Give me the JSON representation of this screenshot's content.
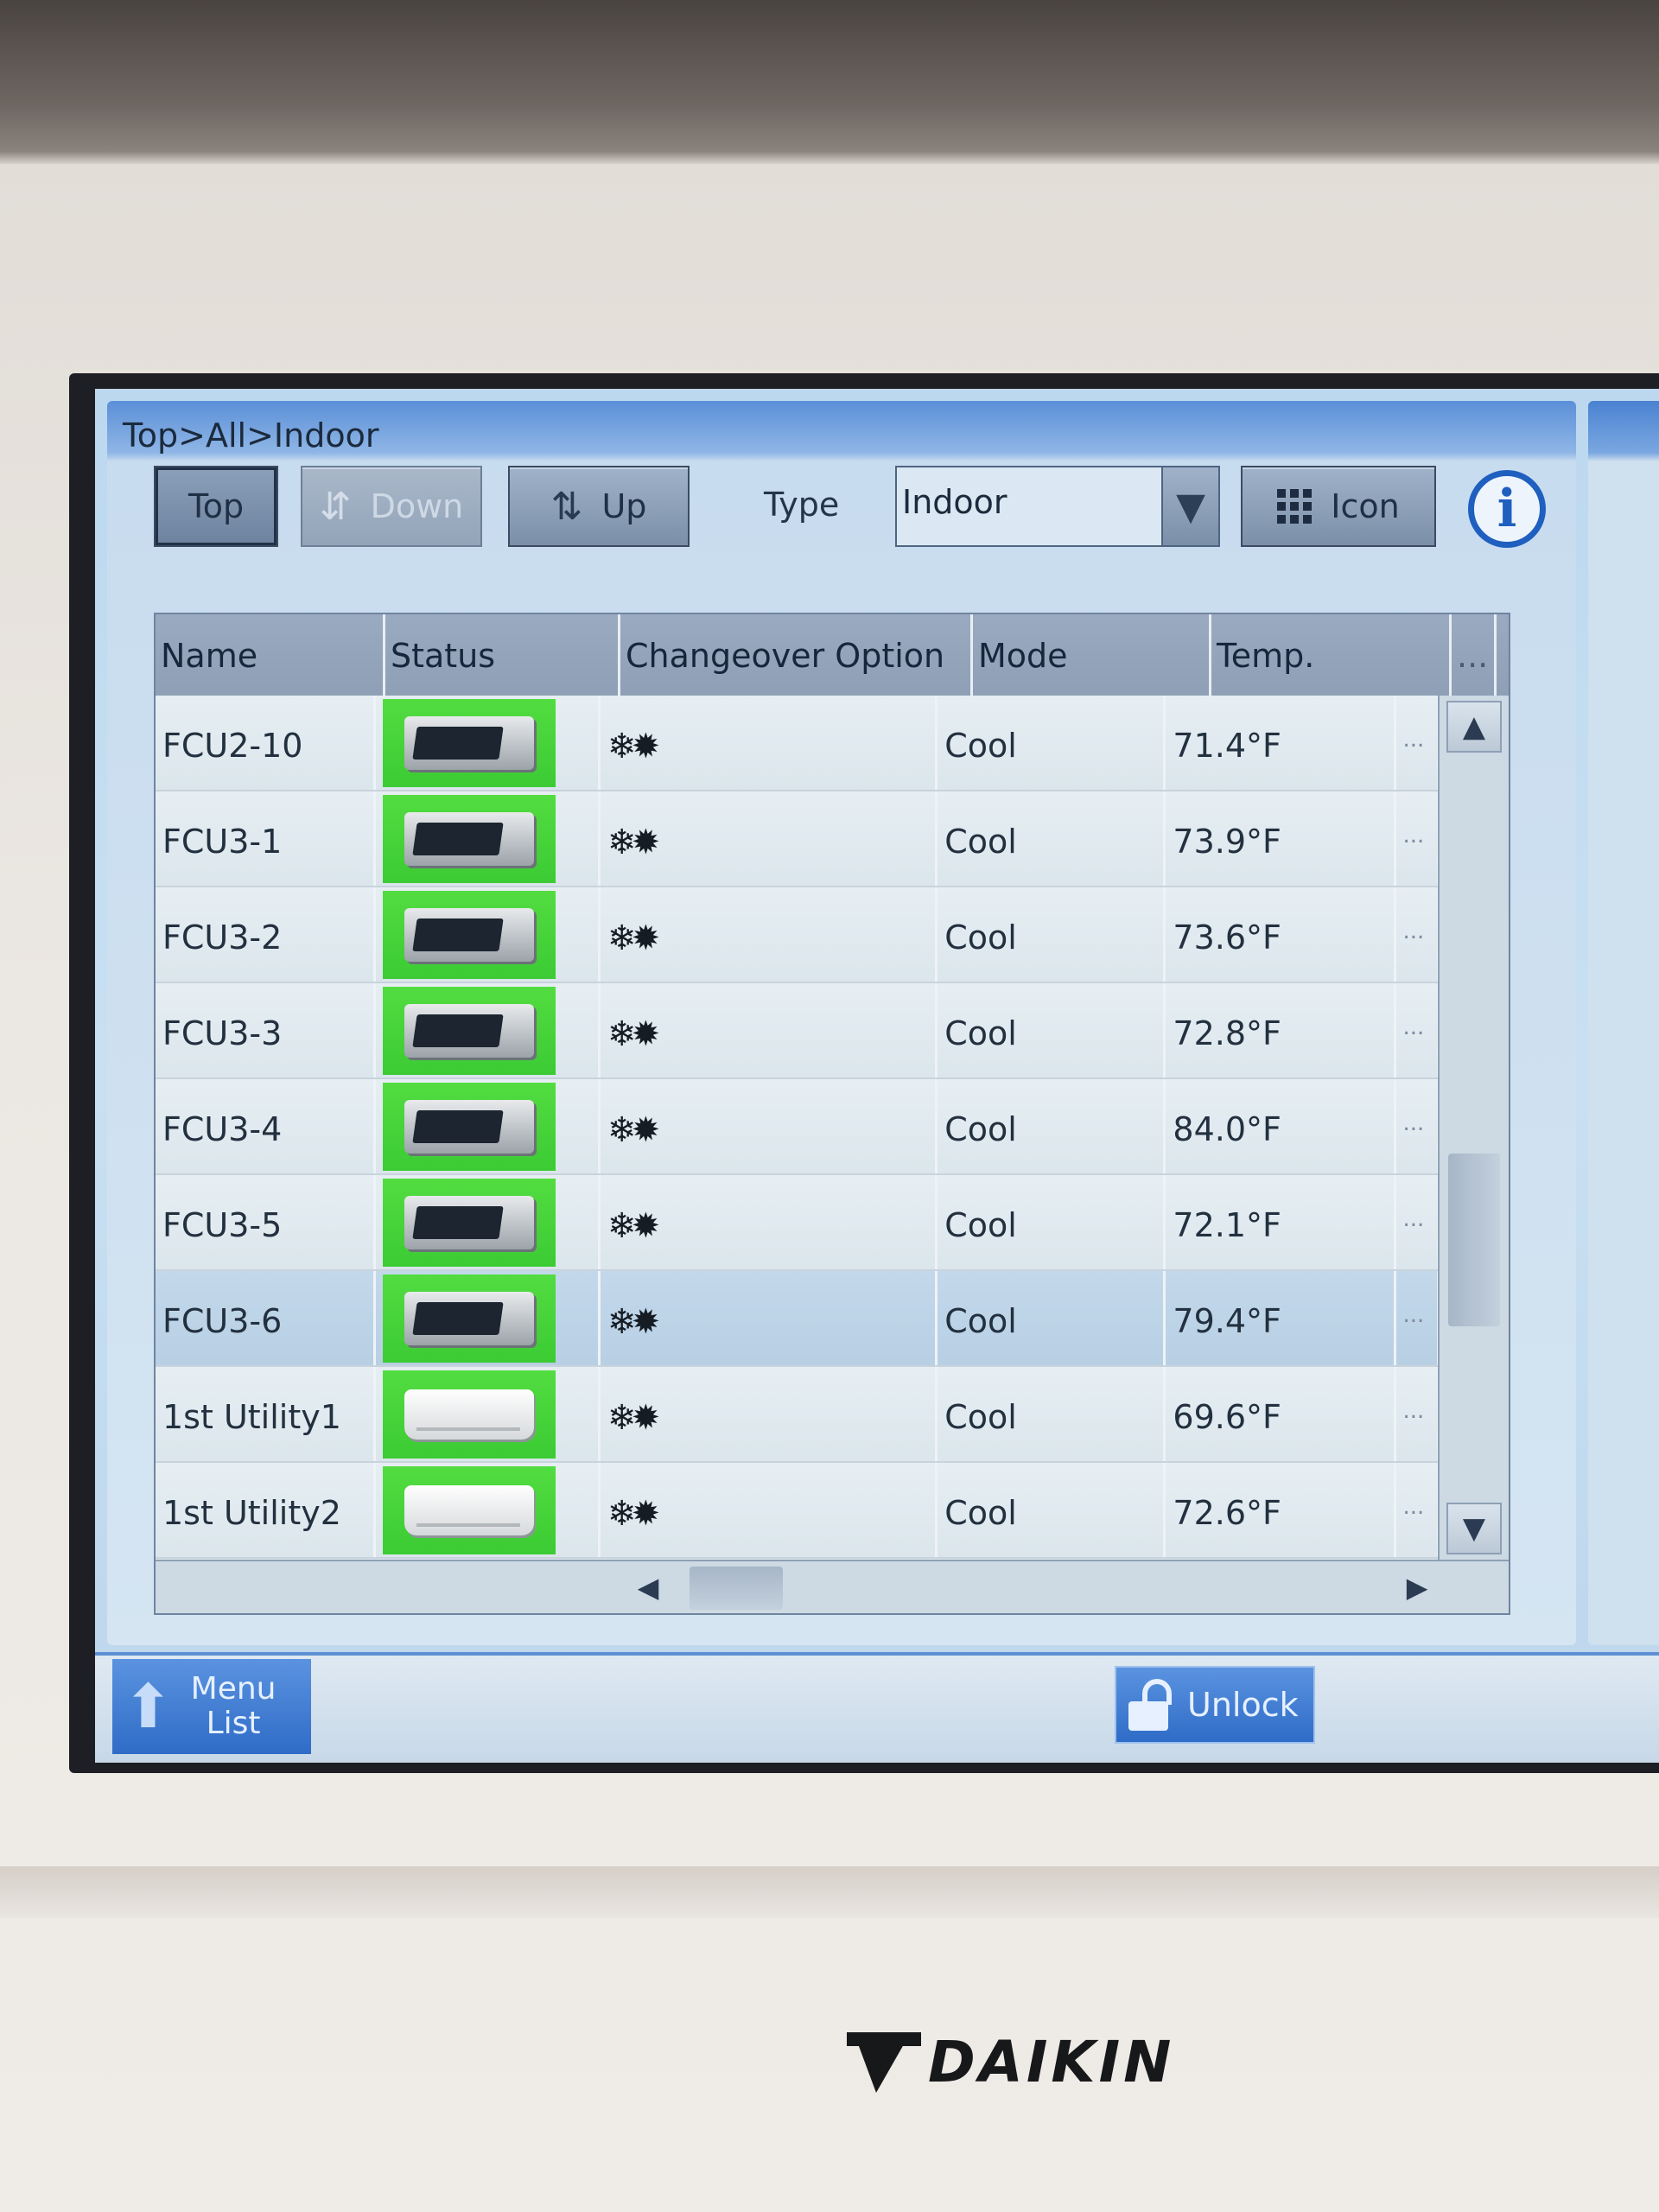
{
  "breadcrumb": "Top>All>Indoor",
  "toolbar": {
    "top_label": "Top",
    "down_label": "Down",
    "up_label": "Up",
    "type_label": "Type",
    "type_value": "Indoor",
    "view_label": "Icon"
  },
  "table": {
    "headers": [
      "Name",
      "Status",
      "Changeover Option",
      "Mode",
      "Temp.",
      "..."
    ],
    "rows": [
      {
        "name": "FCU2-10",
        "status_icon": "duct-unit-icon",
        "changeover": "❄✹",
        "mode": "Cool",
        "temp": "71.4°F",
        "more": "..."
      },
      {
        "name": "FCU3-1",
        "status_icon": "duct-unit-icon",
        "changeover": "❄✹",
        "mode": "Cool",
        "temp": "73.9°F",
        "more": "..."
      },
      {
        "name": "FCU3-2",
        "status_icon": "duct-unit-icon",
        "changeover": "❄✹",
        "mode": "Cool",
        "temp": "73.6°F",
        "more": "..."
      },
      {
        "name": "FCU3-3",
        "status_icon": "duct-unit-icon",
        "changeover": "❄✹",
        "mode": "Cool",
        "temp": "72.8°F",
        "more": "..."
      },
      {
        "name": "FCU3-4",
        "status_icon": "duct-unit-icon",
        "changeover": "❄✹",
        "mode": "Cool",
        "temp": "84.0°F",
        "more": "..."
      },
      {
        "name": "FCU3-5",
        "status_icon": "duct-unit-icon",
        "changeover": "❄✹",
        "mode": "Cool",
        "temp": "72.1°F",
        "more": "..."
      },
      {
        "name": "FCU3-6",
        "status_icon": "duct-unit-icon",
        "changeover": "❄✹",
        "mode": "Cool",
        "temp": "79.4°F",
        "more": "...",
        "selected": true
      },
      {
        "name": "1st Utility1",
        "status_icon": "wall-unit-icon",
        "changeover": "❄✹",
        "mode": "Cool",
        "temp": "69.6°F",
        "more": "..."
      },
      {
        "name": "1st Utility2",
        "status_icon": "wall-unit-icon",
        "changeover": "❄✹",
        "mode": "Cool",
        "temp": "72.6°F",
        "more": "..."
      }
    ]
  },
  "footer": {
    "menu_label_line1": "Menu",
    "menu_label_line2": "List",
    "unlock_label": "Unlock"
  },
  "brand": "DAIKIN",
  "colors": {
    "status_on": "#3ccb34",
    "accent": "#2f6cc7",
    "selected_row": "#bcd3e7"
  }
}
